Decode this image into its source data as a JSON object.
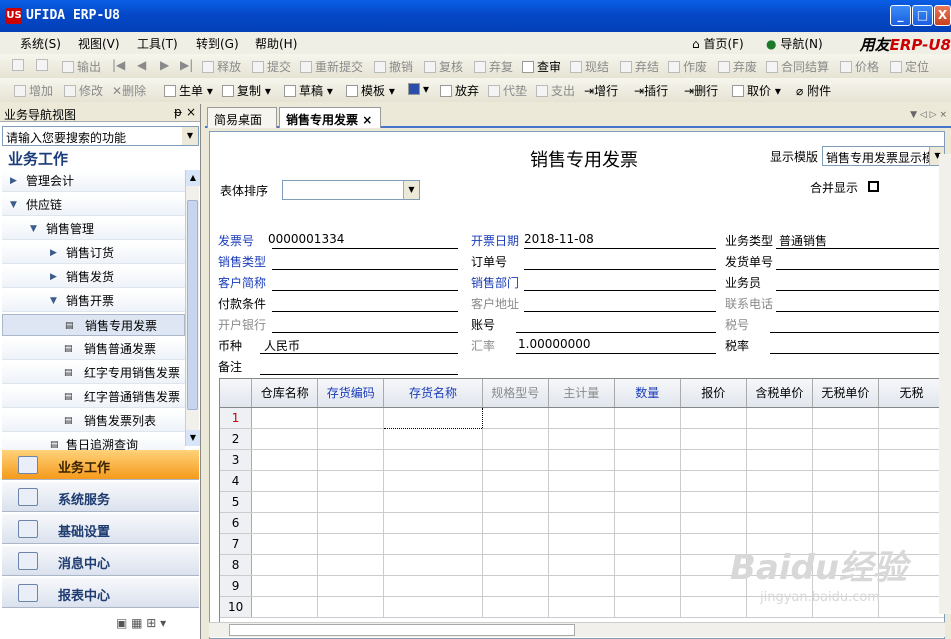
{
  "window": {
    "title": "UFIDA ERP-U8",
    "logo": "US",
    "minimize": "_",
    "maximize": "□",
    "close": "X"
  },
  "menu": {
    "items": [
      "系统(S)",
      "视图(V)",
      "工具(T)",
      "转到(G)",
      "帮助(H)"
    ],
    "home": "首页(F)",
    "navigate": "导航(N)",
    "brand_a": "用友",
    "brand_b": "ERP-U8"
  },
  "toolbar1": [
    "打印",
    "预览",
    "输出",
    "首张",
    "上张",
    "下张",
    "末张",
    "释放",
    "提交",
    "重新提交",
    "撤销",
    "复核",
    "弃复",
    "查审",
    "现结",
    "弃结",
    "作废",
    "弃废",
    "合同结算",
    "价格",
    "定位"
  ],
  "toolbar2": [
    "增加",
    "修改",
    "删除",
    "生单",
    "复制",
    "草稿",
    "模板",
    "保存",
    "放弃",
    "代垫",
    "支出",
    "增行",
    "插行",
    "删行",
    "取价",
    "附件"
  ],
  "nav": {
    "header": "业务导航视图",
    "pin": "ᵽ",
    "close": "×",
    "search_placeholder": "请输入您要搜索的功能",
    "title": "业务工作",
    "tree": [
      {
        "label": "管理会计",
        "level": 0,
        "expanded": false
      },
      {
        "label": "供应链",
        "level": 0,
        "expanded": true
      },
      {
        "label": "销售管理",
        "level": 1,
        "expanded": true
      },
      {
        "label": "销售订货",
        "level": 2,
        "expanded": false
      },
      {
        "label": "销售发货",
        "level": 2,
        "expanded": false
      },
      {
        "label": "销售开票",
        "level": 2,
        "expanded": true
      },
      {
        "label": "销售专用发票",
        "level": 3,
        "selected": true
      },
      {
        "label": "销售普通发票",
        "level": 3
      },
      {
        "label": "红字专用销售发票",
        "level": 3
      },
      {
        "label": "红字普通销售发票",
        "level": 3
      },
      {
        "label": "销售发票列表",
        "level": 3
      },
      {
        "label": "售日追溯查询",
        "level": 2
      }
    ],
    "buttons": [
      "业务工作",
      "系统服务",
      "基础设置",
      "消息中心",
      "报表中心"
    ]
  },
  "tabs": [
    {
      "label": "简易桌面"
    },
    {
      "label": "销售专用发票",
      "active": true
    }
  ],
  "form": {
    "title": "销售专用发票",
    "display_template_label": "显示模版",
    "display_template_value": "销售专用发票显示模版",
    "sort_label": "表体排序",
    "merge_label": "合并显示",
    "fields": {
      "invoice_no_label": "发票号",
      "invoice_no": "0000001334",
      "date_label": "开票日期",
      "date": "2018-11-08",
      "biz_type_label": "业务类型",
      "biz_type": "普通销售",
      "sales_type_label": "销售类型",
      "order_no_label": "订单号",
      "ship_no_label": "发货单号",
      "customer_label": "客户简称",
      "dept_label": "销售部门",
      "salesman_label": "业务员",
      "payment_label": "付款条件",
      "address_label": "客户地址",
      "phone_label": "联系电话",
      "bank_label": "开户银行",
      "account_label": "账号",
      "tax_no_label": "税号",
      "currency_label": "币种",
      "currency": "人民币",
      "rate_label": "汇率",
      "rate": "1.00000000",
      "tax_rate_label": "税率",
      "remark_label": "备注"
    },
    "grid": {
      "columns": [
        {
          "label": "",
          "style": "black"
        },
        {
          "label": "仓库名称",
          "style": "black"
        },
        {
          "label": "存货编码",
          "style": "blue"
        },
        {
          "label": "存货名称",
          "style": "blue"
        },
        {
          "label": "规格型号",
          "style": "gray"
        },
        {
          "label": "主计量",
          "style": "gray"
        },
        {
          "label": "数量",
          "style": "blue"
        },
        {
          "label": "报价",
          "style": "black"
        },
        {
          "label": "含税单价",
          "style": "black"
        },
        {
          "label": "无税单价",
          "style": "black"
        },
        {
          "label": "无税",
          "style": "black"
        }
      ],
      "rows": [
        "1",
        "2",
        "3",
        "4",
        "5",
        "6",
        "7",
        "8",
        "9",
        "10"
      ]
    }
  },
  "watermark": {
    "text": "Baidu经验",
    "url": "jingyan.baidu.com"
  }
}
